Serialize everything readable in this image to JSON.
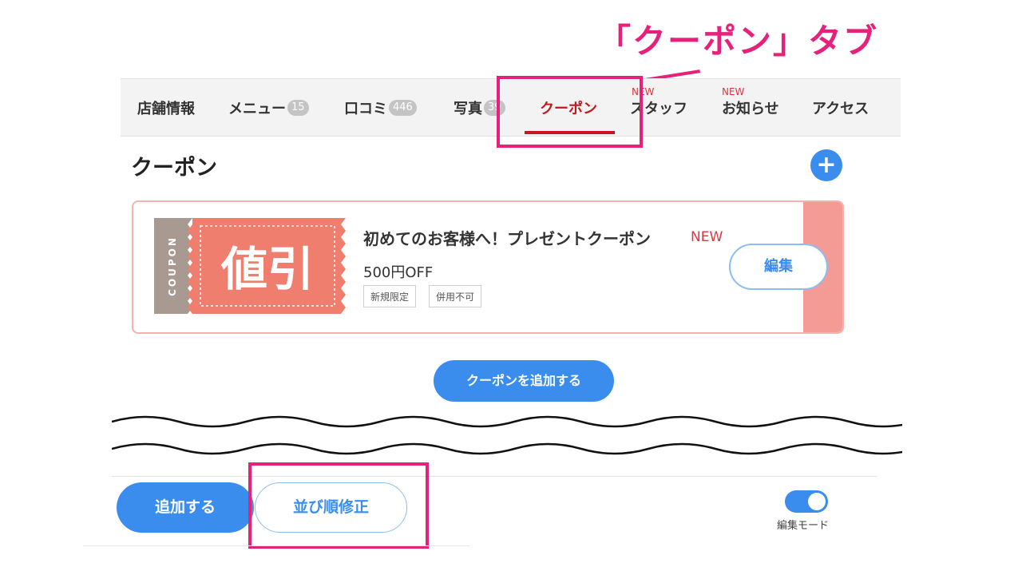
{
  "annotations": {
    "coupon_tab_label": "「クーポン」タブ"
  },
  "tabs": [
    {
      "label": "店舗情報"
    },
    {
      "label": "メニュー",
      "count": "15"
    },
    {
      "label": "口コミ",
      "count": "446"
    },
    {
      "label": "写真",
      "count": "39"
    },
    {
      "label": "クーポン",
      "active": true
    },
    {
      "label": "スタッフ",
      "badge": "NEW"
    },
    {
      "label": "お知らせ",
      "badge": "NEW"
    },
    {
      "label": "アクセス"
    }
  ],
  "section": {
    "title": "クーポン",
    "add_icon": "+"
  },
  "coupon": {
    "stub_text": "COUPON",
    "graphic_text": "値引",
    "title": "初めてのお客様へ！プレゼントクーポン",
    "new_label": "NEW",
    "value": "500円OFF",
    "tags": [
      "新規限定",
      "併用不可"
    ],
    "edit_label": "編集"
  },
  "add_coupon_label": "クーポンを追加する",
  "footer": {
    "add_label": "追加する",
    "sort_label": "並び順修正",
    "toggle_label": "編集モード"
  },
  "colors": {
    "accent_blue": "#3b8ded",
    "active_red": "#c8161d",
    "annotation_pink": "#e6217a",
    "coupon_salmon": "#f07e6e",
    "coupon_stub": "#a89a90"
  }
}
